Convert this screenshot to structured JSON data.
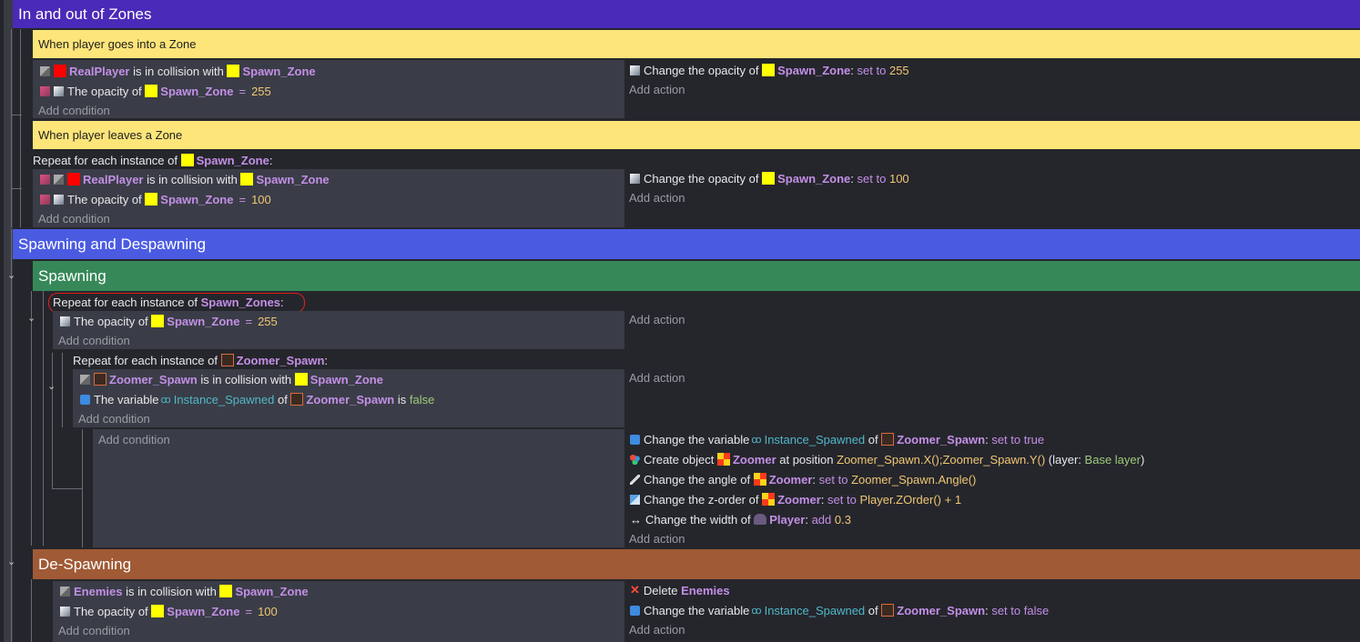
{
  "groups": {
    "zones": "In and out of Zones",
    "spawn_despawn": "Spawning and Despawning",
    "spawning": "Spawning",
    "despawning": "De-Spawning"
  },
  "colors": {
    "group_zones": "#4a2ab8",
    "group_spawn_despawn": "#4a5be2",
    "group_spawning": "#368858",
    "group_despawning": "#a05a35",
    "comment": "#fde57a",
    "highlight_ring": "#e02020"
  },
  "comments": {
    "enter": "When player goes into a Zone",
    "leave": "When player leaves a Zone"
  },
  "common": {
    "add_condition": "Add condition",
    "add_action": "Add action",
    "repeat_prefix": "Repeat for each instance of",
    "colon": ":",
    "is_in_collision_with": "is in collision with",
    "opacity_of": "The opacity of",
    "change_opacity_of": "Change the opacity of",
    "set_to": "set to",
    "eq": "=",
    "the_variable": "The variable",
    "of": "of",
    "is": "is",
    "change_variable": "Change the variable",
    "create_object": "Create object",
    "at_position": "at position",
    "layer_prefix": "(layer:",
    "layer_suffix": ")",
    "change_angle_of": "Change the angle of",
    "change_zorder_of": "Change the z-order of",
    "change_width_of": "Change the width of",
    "add": "add",
    "delete": "Delete"
  },
  "objects": {
    "real_player": "RealPlayer",
    "spawn_zone": "Spawn_Zone",
    "spawn_zones": "Spawn_Zones",
    "zoomer_spawn": "Zoomer_Spawn",
    "zoomer": "Zoomer",
    "player": "Player",
    "enemies": "Enemies"
  },
  "values": {
    "v255": "255",
    "v100": "100",
    "false": "false",
    "true": "true",
    "instance_spawned": "Instance_Spawned",
    "pos_expr": "Zoomer_Spawn.X();Zoomer_Spawn.Y()",
    "base_layer": "Base layer",
    "angle_expr": "Zoomer_Spawn.Angle()",
    "zorder_expr": "Player.ZOrder() + 1",
    "width_add": "0.3"
  },
  "icons": [
    "collision-icon",
    "inverted-icon",
    "opacity-icon",
    "variable-icon",
    "create-object-icon",
    "angle-icon",
    "z-order-icon",
    "width-icon",
    "delete-icon",
    "chevron-down-icon"
  ]
}
